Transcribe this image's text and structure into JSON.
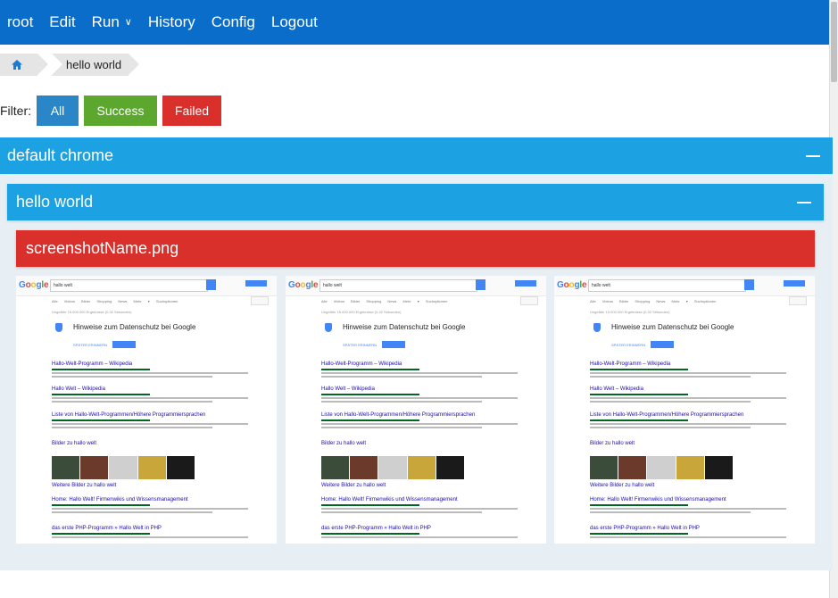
{
  "nav": {
    "items": [
      "root",
      "Edit",
      "Run",
      "History",
      "Config",
      "Logout"
    ]
  },
  "breadcrumb": {
    "home_icon": "home-icon",
    "current": "hello world"
  },
  "filter": {
    "label": "Filter:",
    "buttons": [
      {
        "label": "All",
        "color": "#2a86c6"
      },
      {
        "label": "Success",
        "color": "#5ca72e"
      },
      {
        "label": "Failed",
        "color": "#d9302c"
      }
    ]
  },
  "groups": {
    "outer_title": "default chrome",
    "inner_title": "hello world",
    "screenshot_name": "screenshotName.png"
  },
  "thumbnail": {
    "query": "hallo welt",
    "tabs": "Alle Videos Bilder Shopping News Mehr ▾ Suchoptionen",
    "result_count": "Ungefähr 15.000.000 Ergebnisse (0,32 Sekunden)",
    "privacy_title": "Hinweise zum Datenschutz bei Google",
    "privacy_later": "SPÄTER ERINNERN",
    "results": [
      "Hallo-Welt-Programm – Wikipedia",
      "Hallo Welt – Wikipedia",
      "Liste von Hallo-Welt-Programmen/Höhere Programmiersprachen",
      "Bilder zu hallo welt",
      "Home: Hallo Welt! Firmenwikis und Wissensmanagement",
      "das erste PHP-Programm » Hallo Welt in PHP"
    ],
    "more_images": "Weitere Bilder zu hallo welt"
  },
  "colors": {
    "navbar": "#0a6dc9",
    "panel": "#1ca1e3",
    "failed": "#d9302c"
  }
}
